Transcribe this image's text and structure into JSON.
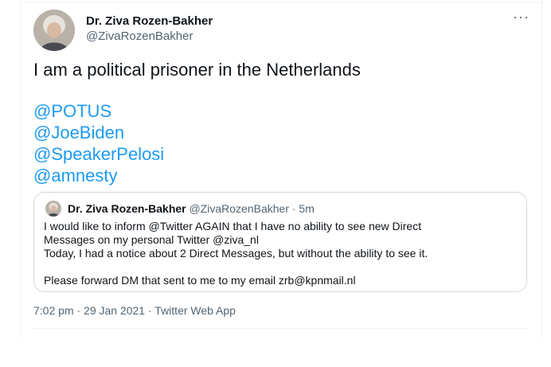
{
  "author": {
    "name": "Dr. Ziva Rozen-Bakher",
    "handle": "@ZivaRozenBakher"
  },
  "more_label": "···",
  "tweet": {
    "text": "I am a political prisoner in the Netherlands",
    "mentions": [
      "@POTUS",
      "@JoeBiden",
      "@SpeakerPelosi",
      "@amnesty"
    ]
  },
  "quote": {
    "name": "Dr. Ziva Rozen-Bakher",
    "meta": "@ZivaRozenBakher · 5m",
    "lines": [
      "I would like to inform @Twitter AGAIN that I have no ability to see new Direct",
      "Messages on my personal Twitter @ziva_nl",
      "Today, I had a notice about 2 Direct Messages, but without the ability to see it.",
      "",
      "Please forward DM that sent to me to my email zrb@kpnmail.nl"
    ]
  },
  "timestamp": "7:02 pm · 29 Jan 2021 · Twitter Web App",
  "colors": {
    "link": "#1d9bf0",
    "secondary_text": "#536471",
    "border": "#cfd9de"
  }
}
